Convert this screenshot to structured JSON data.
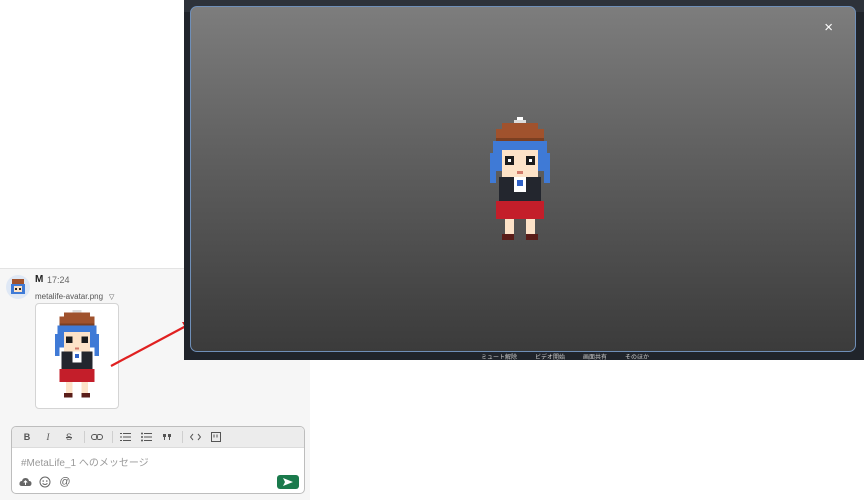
{
  "viewer": {
    "close_label": "×",
    "taskbar": [
      "ミュート解除",
      "ビデオ開始",
      "画面共有",
      "そのほか"
    ]
  },
  "message": {
    "sender": "M",
    "time": "17:24",
    "filename": "metalife-avatar.png",
    "caret": "▽"
  },
  "composer": {
    "placeholder": "#MetaLife_1 へのメッセージ",
    "toolbar": {
      "bold": "B",
      "italic": "I",
      "strike": "S"
    }
  },
  "colors": {
    "send_button": "#1a7a4c",
    "arrow": "#e02020",
    "hat": "#a0522d",
    "hair": "#3f7ad6",
    "skirt": "#c41e2a"
  }
}
